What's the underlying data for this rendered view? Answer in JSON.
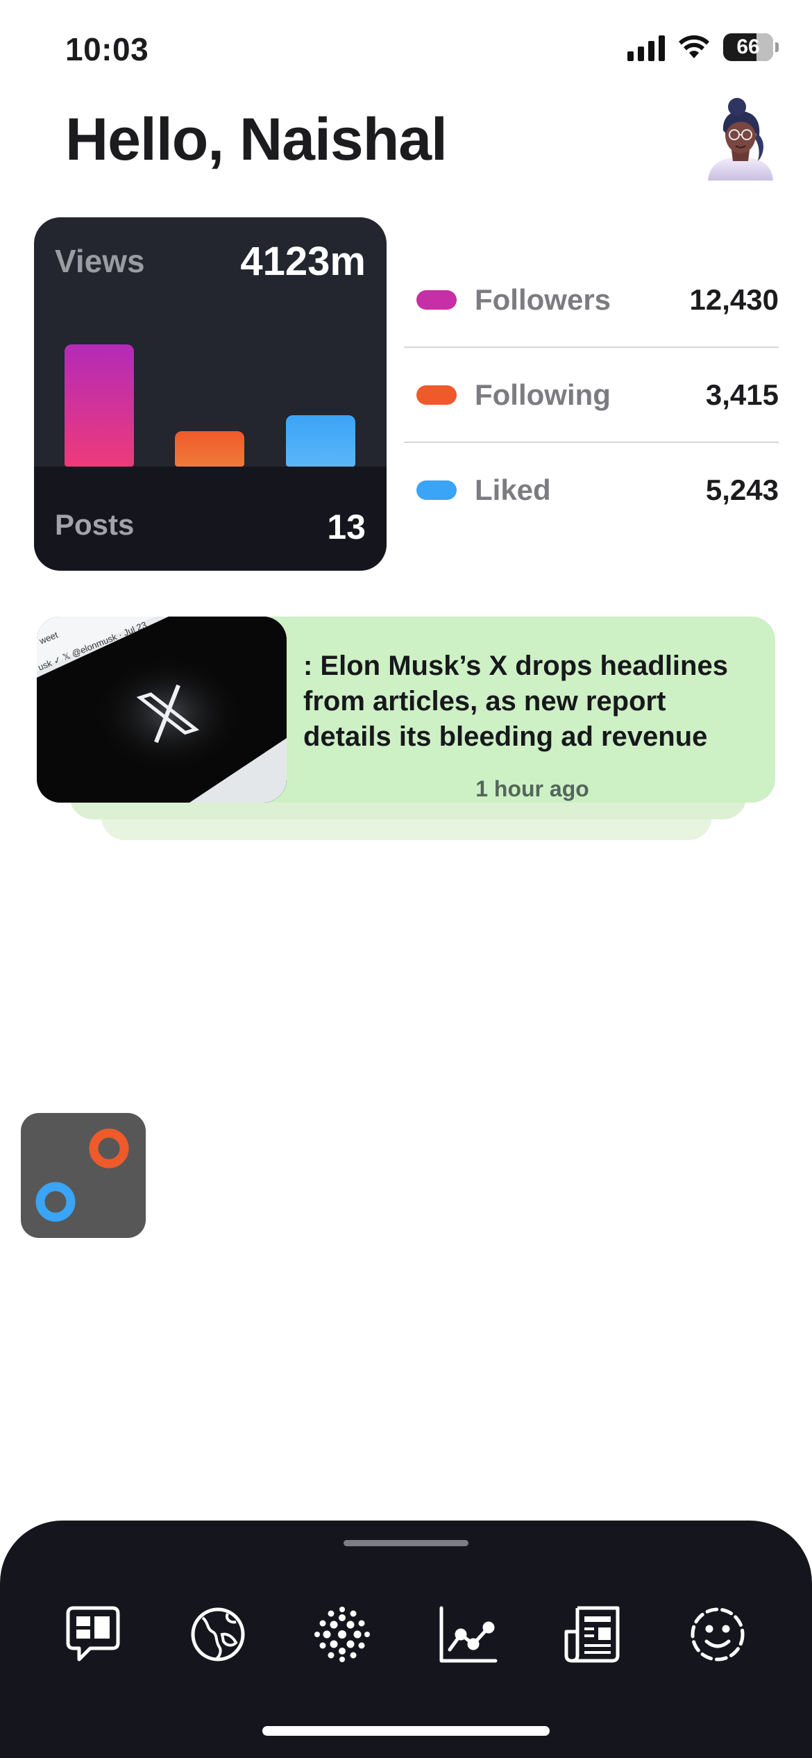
{
  "status_bar": {
    "time": "10:03",
    "battery": "66"
  },
  "header": {
    "greeting": "Hello, Naishal",
    "avatar_icon": "user-avatar"
  },
  "views_card": {
    "views_label": "Views",
    "views_value": "4123m",
    "posts_label": "Posts",
    "posts_value": "13",
    "bars": [
      {
        "key": "followers",
        "level": 1.0
      },
      {
        "key": "following",
        "level": 0.29
      },
      {
        "key": "liked",
        "level": 0.42
      }
    ]
  },
  "stats": [
    {
      "label": "Followers",
      "value": "12,430",
      "color": "#c62fa5"
    },
    {
      "label": "Following",
      "value": "3,415",
      "color": "#ef5a2a"
    },
    {
      "label": "Liked",
      "value": "5,243",
      "color": "#3aa4f6"
    }
  ],
  "news": {
    "title": ": Elon Musk’s X drops headlines from articles, as new report details its bleeding ad revenue",
    "time": "1 hour ago",
    "thumbnail_icon": "x-logo-image",
    "background": "#cdf0c5"
  },
  "tabbar": {
    "items": [
      {
        "name": "chat-dashboard-icon"
      },
      {
        "name": "globe-icon"
      },
      {
        "name": "dots-sphere-icon"
      },
      {
        "name": "line-chart-icon"
      },
      {
        "name": "newspaper-icon"
      },
      {
        "name": "smiley-icon"
      }
    ]
  }
}
